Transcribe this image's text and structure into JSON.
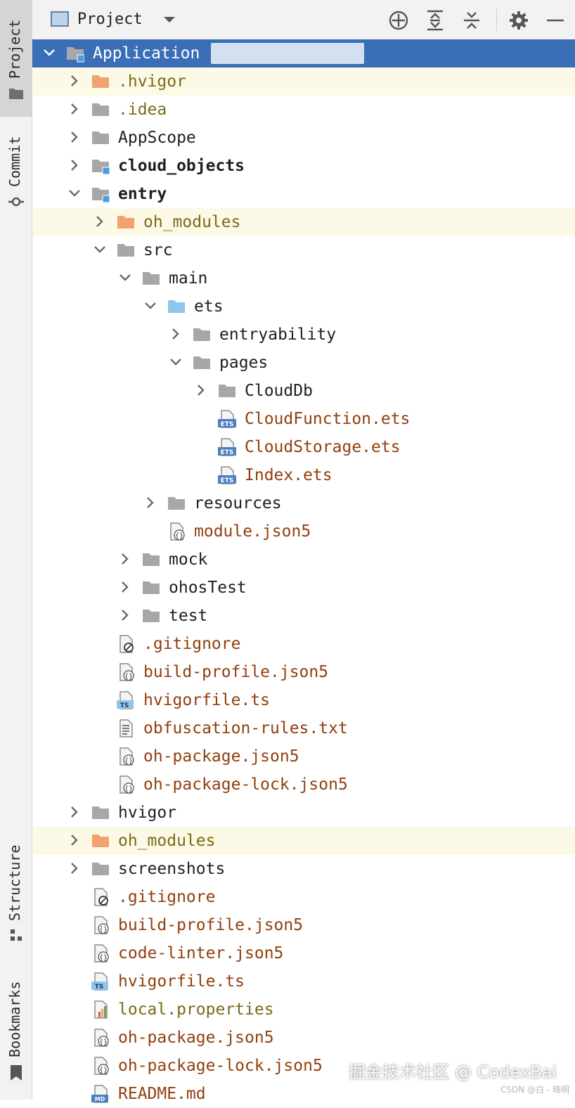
{
  "strip": {
    "tabs": [
      {
        "label": "Project",
        "icon": "folder-icon"
      },
      {
        "label": "Commit",
        "icon": "commit-icon"
      },
      {
        "label": "Structure",
        "icon": "structure-icon"
      },
      {
        "label": "Bookmarks",
        "icon": "bookmark-icon"
      }
    ]
  },
  "header": {
    "title": "Project",
    "buttons": [
      "locate-icon",
      "expand-all-icon",
      "collapse-all-icon",
      "gear-icon",
      "minimize-icon"
    ]
  },
  "tree": {
    "rows": [
      {
        "label": "Application",
        "icon": "module-folder",
        "chevron": "down",
        "style": "white",
        "selected": true
      },
      {
        "label": ".hvigor",
        "icon": "folder-orange",
        "chevron": "right",
        "style": "olive",
        "highlight": true
      },
      {
        "label": ".idea",
        "icon": "folder",
        "chevron": "right",
        "style": "olive"
      },
      {
        "label": "AppScope",
        "icon": "folder",
        "chevron": "right",
        "style": "normal"
      },
      {
        "label": "cloud_objects",
        "icon": "module-folder",
        "chevron": "right",
        "style": "bold"
      },
      {
        "label": "entry",
        "icon": "module-folder",
        "chevron": "down",
        "style": "bold"
      },
      {
        "label": "oh_modules",
        "icon": "folder-orange",
        "chevron": "right",
        "style": "olive",
        "highlight": true
      },
      {
        "label": "src",
        "icon": "folder",
        "chevron": "down",
        "style": "normal"
      },
      {
        "label": "main",
        "icon": "folder",
        "chevron": "down",
        "style": "normal"
      },
      {
        "label": "ets",
        "icon": "folder-blue",
        "chevron": "down",
        "style": "normal"
      },
      {
        "label": "entryability",
        "icon": "folder",
        "chevron": "right",
        "style": "normal"
      },
      {
        "label": "pages",
        "icon": "folder",
        "chevron": "down",
        "style": "normal"
      },
      {
        "label": "CloudDb",
        "icon": "folder",
        "chevron": "right",
        "style": "normal"
      },
      {
        "label": "CloudFunction.ets",
        "icon": "ets-file",
        "chevron": "none",
        "style": "brown"
      },
      {
        "label": "CloudStorage.ets",
        "icon": "ets-file",
        "chevron": "none",
        "style": "brown"
      },
      {
        "label": "Index.ets",
        "icon": "ets-file",
        "chevron": "none",
        "style": "brown"
      },
      {
        "label": "resources",
        "icon": "folder",
        "chevron": "right",
        "style": "normal"
      },
      {
        "label": "module.json5",
        "icon": "json-file",
        "chevron": "none",
        "style": "brown"
      },
      {
        "label": "mock",
        "icon": "folder",
        "chevron": "right",
        "style": "normal"
      },
      {
        "label": "ohosTest",
        "icon": "folder",
        "chevron": "right",
        "style": "normal"
      },
      {
        "label": "test",
        "icon": "folder",
        "chevron": "right",
        "style": "normal"
      },
      {
        "label": ".gitignore",
        "icon": "ignore-file",
        "chevron": "none",
        "style": "brown"
      },
      {
        "label": "build-profile.json5",
        "icon": "json-file",
        "chevron": "none",
        "style": "brown"
      },
      {
        "label": "hvigorfile.ts",
        "icon": "ts-file",
        "chevron": "none",
        "style": "brown"
      },
      {
        "label": "obfuscation-rules.txt",
        "icon": "text-file",
        "chevron": "none",
        "style": "brown"
      },
      {
        "label": "oh-package.json5",
        "icon": "json-file",
        "chevron": "none",
        "style": "brown"
      },
      {
        "label": "oh-package-lock.json5",
        "icon": "json-file",
        "chevron": "none",
        "style": "brown"
      },
      {
        "label": "hvigor",
        "icon": "folder",
        "chevron": "right",
        "style": "normal"
      },
      {
        "label": "oh_modules",
        "icon": "folder-orange",
        "chevron": "right",
        "style": "olive",
        "highlight": true
      },
      {
        "label": "screenshots",
        "icon": "folder",
        "chevron": "right",
        "style": "normal"
      },
      {
        "label": ".gitignore",
        "icon": "ignore-file",
        "chevron": "none",
        "style": "brown"
      },
      {
        "label": "build-profile.json5",
        "icon": "json-file",
        "chevron": "none",
        "style": "brown"
      },
      {
        "label": "code-linter.json5",
        "icon": "json-file",
        "chevron": "none",
        "style": "brown"
      },
      {
        "label": "hvigorfile.ts",
        "icon": "ts-file",
        "chevron": "none",
        "style": "brown"
      },
      {
        "label": "local.properties",
        "icon": "properties-file",
        "chevron": "none",
        "style": "olive"
      },
      {
        "label": "oh-package.json5",
        "icon": "json-file",
        "chevron": "none",
        "style": "brown"
      },
      {
        "label": "oh-package-lock.json5",
        "icon": "json-file",
        "chevron": "none",
        "style": "brown"
      },
      {
        "label": "README.md",
        "icon": "md-file",
        "chevron": "none",
        "style": "brown"
      }
    ]
  },
  "watermark": {
    "text": "掘金技术社区 @ CodexBai",
    "sub": "CSDN @白 - 晓明"
  }
}
